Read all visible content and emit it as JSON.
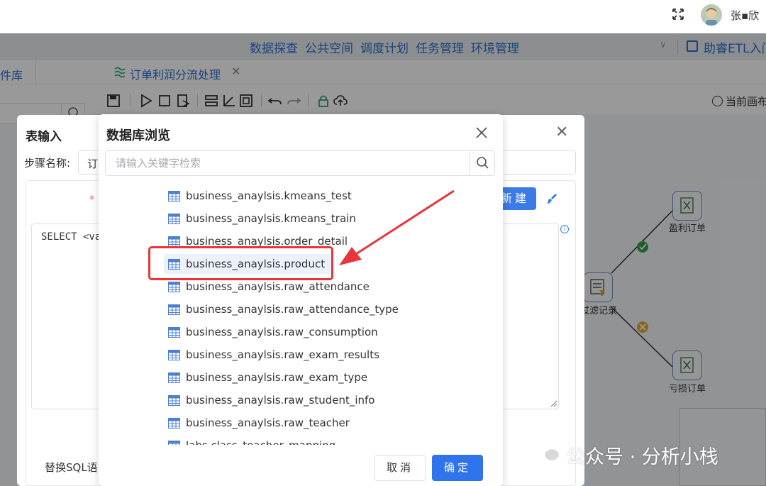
{
  "topbar": {
    "user_name": "张▪欣"
  },
  "menu": {
    "items": [
      "数据探查",
      "公共空间",
      "调度计划",
      "任务管理",
      "环境管理"
    ],
    "project": "助睿ETL入门"
  },
  "tabs": {
    "library": "件库",
    "active": "订单利润分流处理"
  },
  "toolbar": {
    "canvas_status": "当前画布"
  },
  "flow": {
    "nodes": [
      {
        "label": "盈利订单",
        "icon": "excel-output-icon"
      },
      {
        "label": "过滤记录",
        "icon": "filter-icon"
      },
      {
        "label": "亏损订单",
        "icon": "excel-output-icon"
      }
    ]
  },
  "step_dialog": {
    "title": "表输入",
    "step_name_label": "步骤名称:",
    "step_name_value": "订",
    "required_mark": "*",
    "new_button": "新建",
    "sql_text": "SELECT <va",
    "replace_label": "替换SQL语"
  },
  "db_dialog": {
    "title": "数据库浏览",
    "search_placeholder": "请输入关键字检索",
    "items": [
      "business_anaylsis.kmeans_test",
      "business_anaylsis.kmeans_train",
      "business_anaylsis.order_detail",
      "business_anaylsis.product",
      "business_anaylsis.raw_attendance",
      "business_anaylsis.raw_attendance_type",
      "business_anaylsis.raw_consumption",
      "business_anaylsis.raw_exam_results",
      "business_anaylsis.raw_exam_type",
      "business_anaylsis.raw_student_info",
      "business_anaylsis.raw_teacher",
      "labs.class_teacher_mapping"
    ],
    "selected_item": "business_anaylsis.product",
    "cancel_label": "取消",
    "ok_label": "确定"
  },
  "annotation_color": "#e8353a",
  "accent_color": "#2f74ec",
  "watermark": "公众号 · 分析小栈"
}
